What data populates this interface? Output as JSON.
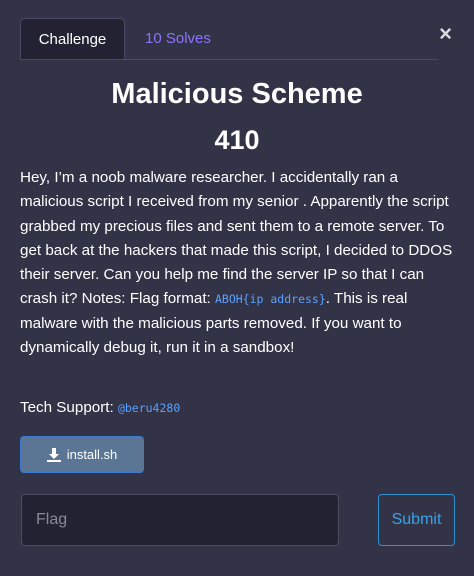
{
  "tabs": {
    "challenge_label": "Challenge",
    "solves_label": "10 Solves"
  },
  "close_symbol": "×",
  "challenge": {
    "title": "Malicious Scheme",
    "points": "410",
    "description_part1": "Hey, I’m a noob malware researcher. I accidentally ran a malicious script I received from my senior . Apparently the script grabbed my precious files and sent them to a remote server. To get back at the hackers that made this script, I decided to DDOS their server. Can you help me find the server IP so that I can crash it? Notes: Flag format: ",
    "flag_format_code": "ABOH{ip address}",
    "description_part2": ". This is real malware with the malicious parts removed. If you want to dynamically debug it, run it in a sandbox!",
    "support_label": "Tech Support: ",
    "support_handle": "@beru4280"
  },
  "file": {
    "name": "install.sh",
    "icon": "download-icon"
  },
  "form": {
    "flag_placeholder": "Flag",
    "flag_value": "",
    "submit_label": "Submit"
  },
  "colors": {
    "background": "#333348",
    "tab_active_bg": "#222233",
    "tab_inactive_text": "#8e72ff",
    "code_text": "#5aa0ff",
    "download_button_bg": "#5a7694",
    "submit_border": "#2b8fd0"
  }
}
